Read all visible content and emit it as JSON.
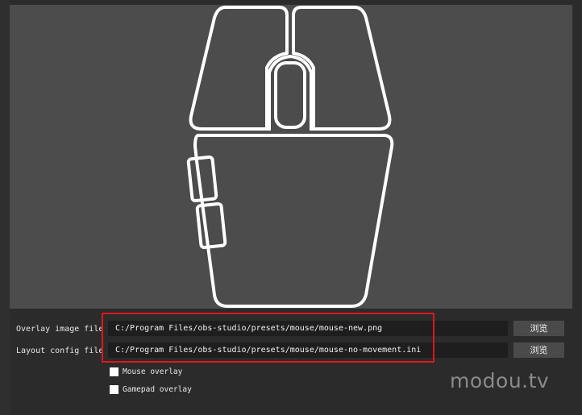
{
  "settings": {
    "overlay_image": {
      "label": "Overlay image file",
      "value": "C:/Program Files/obs-studio/presets/mouse/mouse-new.png",
      "browse_label": "浏览"
    },
    "layout_config": {
      "label": "Layout config file",
      "value": "C:/Program Files/obs-studio/presets/mouse/mouse-no-movement.ini",
      "browse_label": "浏览"
    },
    "mouse_overlay": {
      "label": "Mouse overlay",
      "checked": false
    },
    "gamepad_overlay": {
      "label": "Gamepad overlay",
      "checked": false
    }
  },
  "watermark": "modou.tv",
  "colors": {
    "background": "#2b2b2b",
    "preview": "#4c4c4c",
    "field": "#1e1e1e",
    "button": "#4a4a4a",
    "highlight": "#e0161b",
    "outline": "#ffffff"
  }
}
